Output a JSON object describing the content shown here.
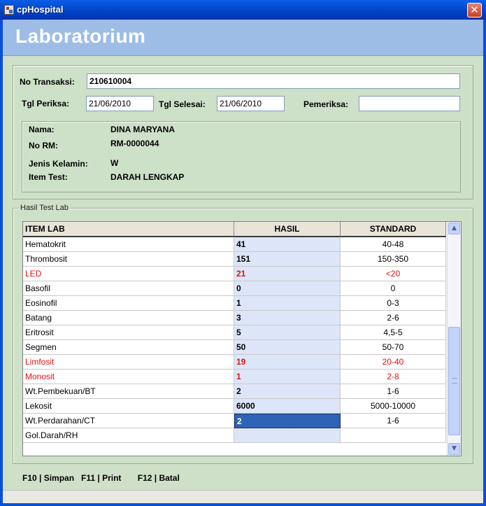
{
  "window": {
    "title": "cpHospital",
    "close_label": "✕"
  },
  "banner": {
    "title": "Laboratorium"
  },
  "form": {
    "no_transaksi_label": "No Transaksi:",
    "no_transaksi_value": "210610004",
    "tgl_periksa_label": "Tgl Periksa:",
    "tgl_periksa_value": "21/06/2010",
    "tgl_selesai_label": "Tgl Selesai:",
    "tgl_selesai_value": "21/06/2010",
    "pemeriksa_label": "Pemeriksa:",
    "pemeriksa_value": ""
  },
  "patient": {
    "nama_label": "Nama:",
    "nama_value": "DINA MARYANA",
    "norm_label": "No RM:",
    "norm_value": "RM-0000044",
    "jk_label": "Jenis Kelamin:",
    "jk_value": "W",
    "item_label": "Item Test:",
    "item_value": "DARAH LENGKAP"
  },
  "group": {
    "legend": "Hasil Test Lab"
  },
  "grid": {
    "headers": {
      "item": "ITEM LAB",
      "hasil": "HASIL",
      "standard": "STANDARD"
    },
    "rows": [
      {
        "item": "Hematokrit",
        "hasil": "41",
        "standard": "40-48",
        "abnormal": false
      },
      {
        "item": "Thrombosit",
        "hasil": "151",
        "standard": "150-350",
        "abnormal": false
      },
      {
        "item": "LED",
        "hasil": "21",
        "standard": "<20",
        "abnormal": true
      },
      {
        "item": "Basofil",
        "hasil": "0",
        "standard": "0",
        "abnormal": false
      },
      {
        "item": "Eosinofil",
        "hasil": "1",
        "standard": "0-3",
        "abnormal": false
      },
      {
        "item": "Batang",
        "hasil": "3",
        "standard": "2-6",
        "abnormal": false
      },
      {
        "item": "Eritrosit",
        "hasil": "5",
        "standard": "4,5-5",
        "abnormal": false
      },
      {
        "item": "Segmen",
        "hasil": "50",
        "standard": "50-70",
        "abnormal": false
      },
      {
        "item": "Limfosit",
        "hasil": "19",
        "standard": "20-40",
        "abnormal": true
      },
      {
        "item": "Monosit",
        "hasil": "1",
        "standard": "2-8",
        "abnormal": true
      },
      {
        "item": "Wt.Pembekuan/BT",
        "hasil": "2",
        "standard": "1-6",
        "abnormal": false
      },
      {
        "item": "Lekosit",
        "hasil": "6000",
        "standard": "5000-10000",
        "abnormal": false
      },
      {
        "item": "Wt.Perdarahan/CT",
        "hasil": "2",
        "standard": "1-6",
        "abnormal": false,
        "selected": true
      },
      {
        "item": "Gol.Darah/RH",
        "hasil": "",
        "standard": "",
        "abnormal": false
      }
    ]
  },
  "footer": {
    "shortcuts": "F10 | Simpan   F11 | Print       F12 | Batal"
  },
  "colors": {
    "abnormal": "#e01010",
    "selected": "#2f63b6",
    "banner": "#9dbde6"
  },
  "icons": {
    "scroll_up": "▲",
    "scroll_down": "▼"
  }
}
